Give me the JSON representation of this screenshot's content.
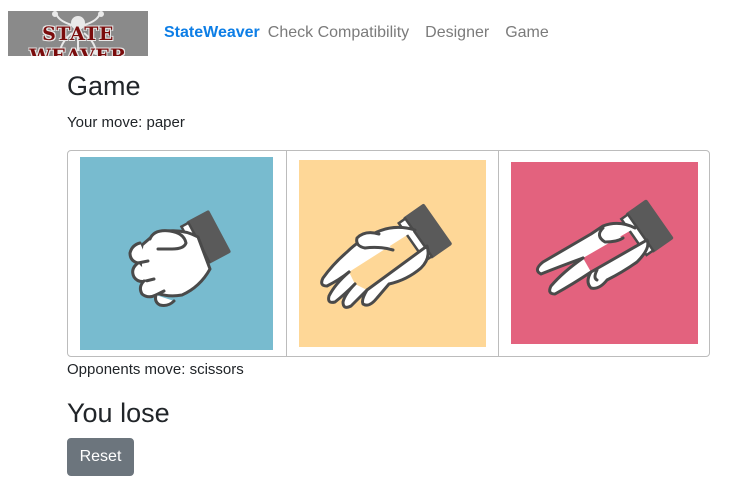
{
  "navbar": {
    "logo_text": "STATE WEAVER",
    "brand": "StateWeaver",
    "links": [
      "Check Compatibility",
      "Designer",
      "Game"
    ]
  },
  "page": {
    "title": "Game",
    "your_move_label": "Your move: paper",
    "opponent_move_label": "Opponents move: scissors",
    "result": "You lose",
    "reset_label": "Reset"
  },
  "choices": [
    {
      "move": "rock",
      "icon": "fist-hand-icon",
      "color": "#78bbcf"
    },
    {
      "move": "paper",
      "icon": "open-hand-icon",
      "color": "#fed797"
    },
    {
      "move": "scissors",
      "icon": "peace-sign-hand-icon",
      "color": "#e3627e"
    }
  ],
  "colors": {
    "brand": "#0d7ee6",
    "nav_link": "#7b7b7b",
    "reset_button": "#6c757d",
    "hand_fill": "#ffffff",
    "hand_outline": "#4a4a4a",
    "cuff": "#5a5a5a"
  }
}
